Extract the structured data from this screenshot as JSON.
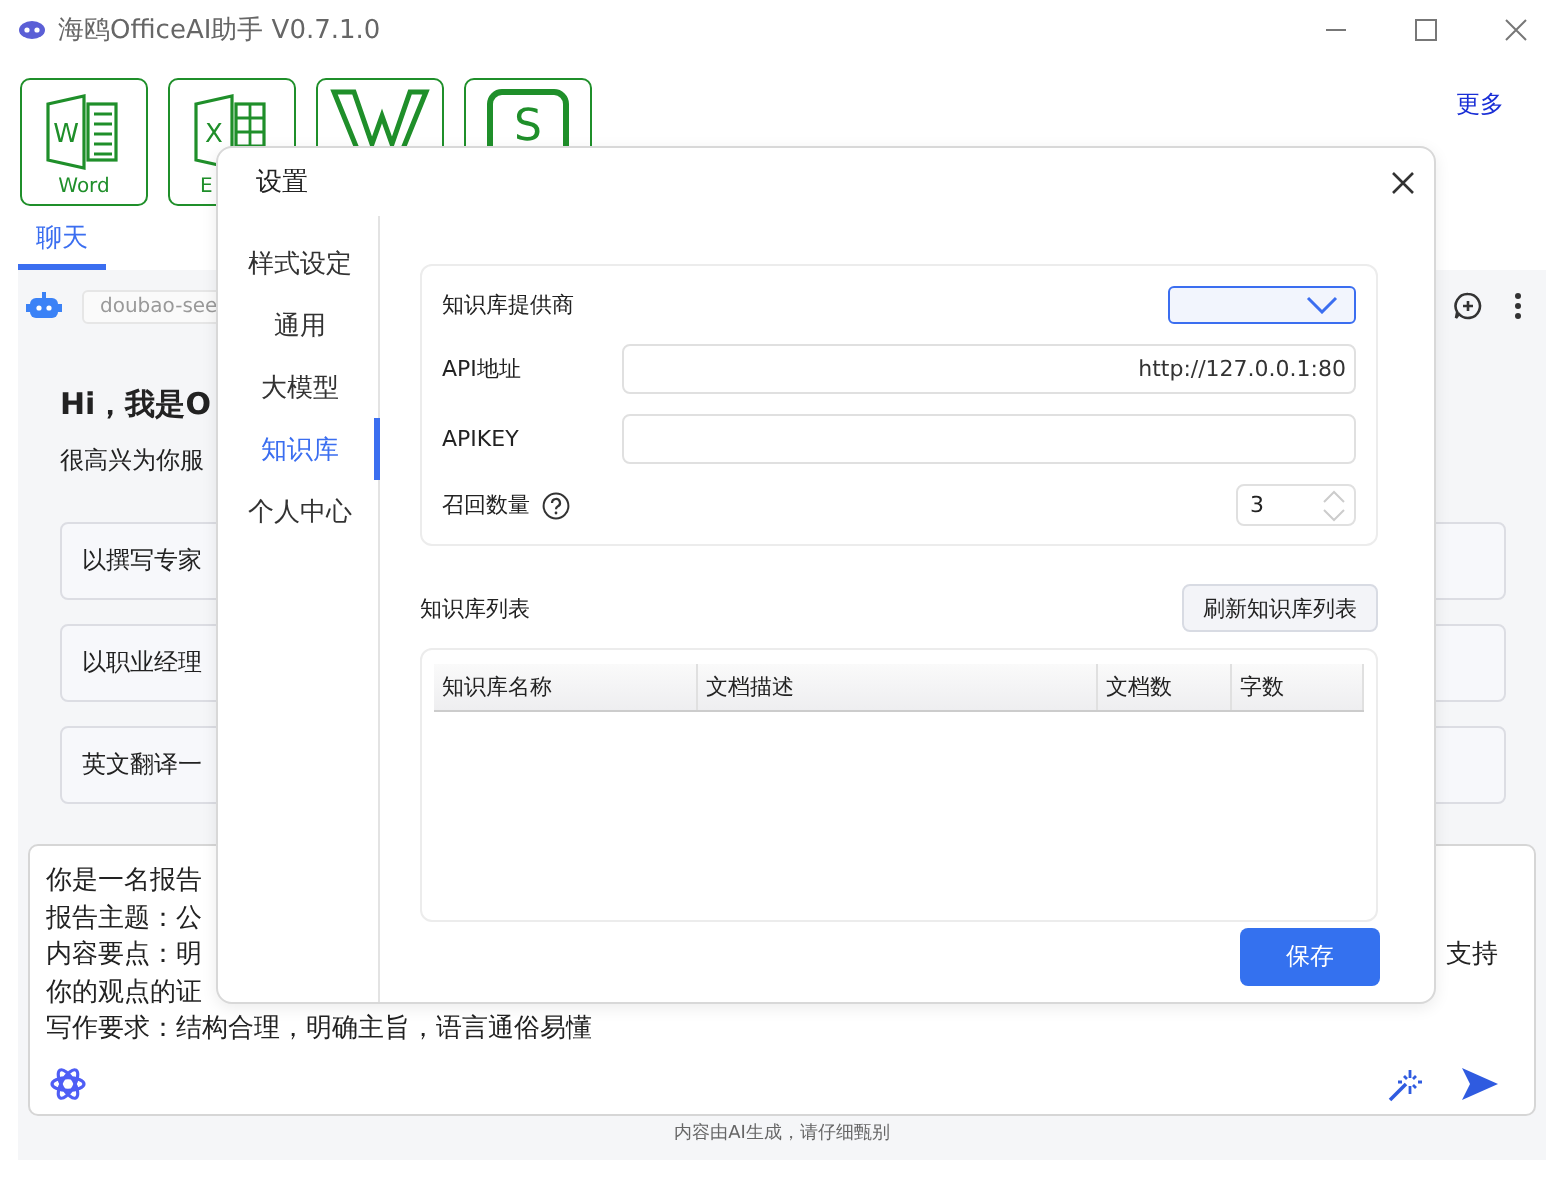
{
  "window": {
    "title": "海鸥OfficeAI助手 V0.7.1.0"
  },
  "toolbar": {
    "apps": [
      {
        "kind": "word",
        "glyph": "W",
        "label": "Word"
      },
      {
        "kind": "excel",
        "glyph": "X",
        "label": "E"
      },
      {
        "kind": "wps"
      },
      {
        "kind": "sheet",
        "glyph": "S"
      }
    ],
    "more": "更多"
  },
  "tabs": [
    {
      "label": "聊天",
      "selected": true
    }
  ],
  "chat": {
    "model": "doubao-see",
    "greeting": "Hi，我是O",
    "subtitle": "很高兴为你服",
    "prompts": [
      "以撰写专家",
      "以职业经理",
      "英文翻译一"
    ],
    "input_lines": [
      {
        "left": "你是一名报告"
      },
      {
        "left": "报告主题：公"
      },
      {
        "left": "内容要点：明",
        "right": "支持"
      },
      {
        "left": "你的观点的证"
      },
      {
        "left": "写作要求：结构合理，明确主旨，语言通俗易懂"
      }
    ],
    "disclaimer": "内容由AI生成，请仔细甄别"
  },
  "dialog": {
    "title": "设置",
    "nav": [
      {
        "label": "样式设定",
        "selected": false
      },
      {
        "label": "通用",
        "selected": false
      },
      {
        "label": "大模型",
        "selected": false
      },
      {
        "label": "知识库",
        "selected": true
      },
      {
        "label": "个人中心",
        "selected": false
      }
    ],
    "provider_label": "知识库提供商",
    "fields": [
      {
        "kind": "text",
        "label": "API地址",
        "value": "http://127.0.0.1:80"
      },
      {
        "kind": "text",
        "label": "APIKEY"
      },
      {
        "kind": "number",
        "label": "召回数量",
        "value": "3",
        "help": true
      }
    ],
    "list_title": "知识库列表",
    "refresh_button": "刷新知识库列表",
    "columns": [
      "知识库名称",
      "文档描述",
      "文档数",
      "字数"
    ],
    "save_button": "保存"
  }
}
